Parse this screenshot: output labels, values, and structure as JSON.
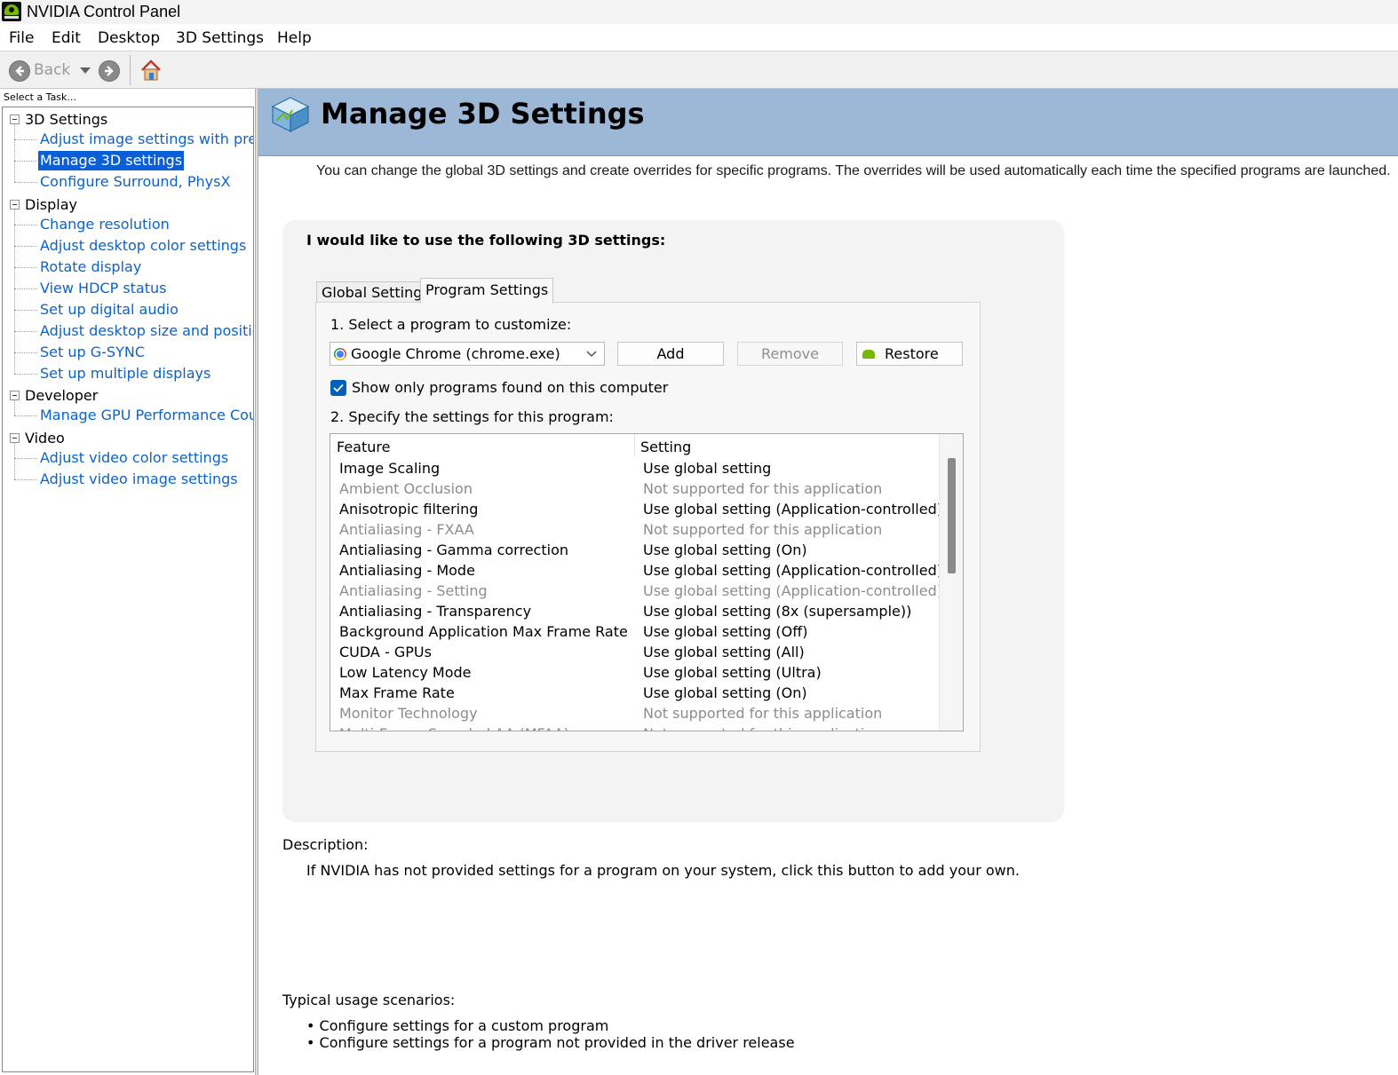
{
  "window": {
    "title": "NVIDIA Control Panel"
  },
  "menu": [
    "File",
    "Edit",
    "Desktop",
    "3D Settings",
    "Help"
  ],
  "toolbar": {
    "back_label": "Back"
  },
  "task_pane": {
    "label": "Select a Task...",
    "categories": [
      {
        "label": "3D Settings",
        "items": [
          "Adjust image settings with preview",
          "Manage 3D settings",
          "Configure Surround, PhysX"
        ]
      },
      {
        "label": "Display",
        "items": [
          "Change resolution",
          "Adjust desktop color settings",
          "Rotate display",
          "View HDCP status",
          "Set up digital audio",
          "Adjust desktop size and position",
          "Set up G-SYNC",
          "Set up multiple displays"
        ]
      },
      {
        "label": "Developer",
        "items": [
          "Manage GPU Performance Counters"
        ]
      },
      {
        "label": "Video",
        "items": [
          "Adjust video color settings",
          "Adjust video image settings"
        ]
      }
    ],
    "selected": "Manage 3D settings"
  },
  "page": {
    "title": "Manage 3D Settings",
    "intro": "You can change the global 3D settings and create overrides for specific programs. The overrides will be used automatically each time the specified programs are launched.",
    "group_heading": "I would like to use the following 3D settings:",
    "tabs": [
      {
        "label": "Global Settings",
        "active": false
      },
      {
        "label": "Program Settings",
        "active": true
      }
    ],
    "step1": "1. Select a program to customize:",
    "program": "Google Chrome (chrome.exe)",
    "buttons": {
      "add": "Add",
      "remove": "Remove",
      "restore": "Restore"
    },
    "show_only_label": "Show only programs found on this computer",
    "show_only_checked": true,
    "step2": "2. Specify the settings for this program:",
    "columns": {
      "feature": "Feature",
      "setting": "Setting"
    },
    "rows": [
      {
        "feature": "Image Scaling",
        "setting": "Use global setting",
        "dim": false
      },
      {
        "feature": "Ambient Occlusion",
        "setting": "Not supported for this application",
        "dim": true
      },
      {
        "feature": "Anisotropic filtering",
        "setting": "Use global setting (Application-controlled)",
        "dim": false
      },
      {
        "feature": "Antialiasing - FXAA",
        "setting": "Not supported for this application",
        "dim": true
      },
      {
        "feature": "Antialiasing - Gamma correction",
        "setting": "Use global setting (On)",
        "dim": false
      },
      {
        "feature": "Antialiasing - Mode",
        "setting": "Use global setting (Application-controlled)",
        "dim": false
      },
      {
        "feature": "Antialiasing - Setting",
        "setting": "Use global setting (Application-controlled)",
        "dim": true
      },
      {
        "feature": "Antialiasing - Transparency",
        "setting": "Use global setting (8x (supersample))",
        "dim": false
      },
      {
        "feature": "Background Application Max Frame Rate",
        "setting": "Use global setting (Off)",
        "dim": false
      },
      {
        "feature": "CUDA - GPUs",
        "setting": "Use global setting (All)",
        "dim": false
      },
      {
        "feature": "Low Latency Mode",
        "setting": "Use global setting (Ultra)",
        "dim": false
      },
      {
        "feature": "Max Frame Rate",
        "setting": "Use global setting (On)",
        "dim": false
      },
      {
        "feature": "Monitor Technology",
        "setting": "Not supported for this application",
        "dim": true
      },
      {
        "feature": "Multi-Frame Sampled AA (MFAA)",
        "setting": "Not supported for this application",
        "dim": true
      }
    ],
    "description_heading": "Description:",
    "description": "If NVIDIA has not provided settings for a program on your system, click this button to add your own.",
    "usage_heading": "Typical usage scenarios:",
    "usage": [
      "• Configure settings for a custom program",
      "• Configure settings for a program not provided in the driver release"
    ]
  },
  "colors": {
    "banner": "#9db7d6",
    "link": "#0b63c9",
    "selection": "#0a5fd6",
    "nvidia_green": "#76b900"
  }
}
